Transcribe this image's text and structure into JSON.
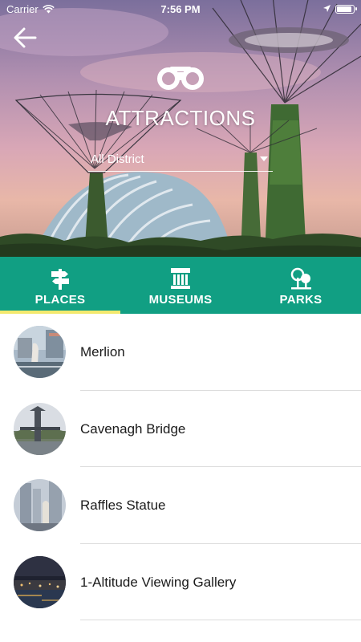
{
  "status_bar": {
    "carrier": "Carrier",
    "time": "7:56 PM"
  },
  "header": {
    "back_icon": "arrow-left-icon",
    "category_icon": "binoculars-icon",
    "title": "ATTRACTIONS",
    "district_select": {
      "selected": "All District"
    }
  },
  "tabs": [
    {
      "label": "PLACES",
      "icon": "signpost-icon",
      "active": true
    },
    {
      "label": "MUSEUMS",
      "icon": "museum-icon",
      "active": false
    },
    {
      "label": "PARKS",
      "icon": "trees-icon",
      "active": false
    }
  ],
  "places": [
    {
      "name": "Merlion"
    },
    {
      "name": "Cavenagh Bridge"
    },
    {
      "name": "Raffles Statue"
    },
    {
      "name": "1-Altitude Viewing Gallery"
    }
  ],
  "colors": {
    "tab_bar": "#119f83",
    "active_indicator": "#f3e96e",
    "text": "#1b1b1b",
    "divider": "#dcdcdc"
  }
}
